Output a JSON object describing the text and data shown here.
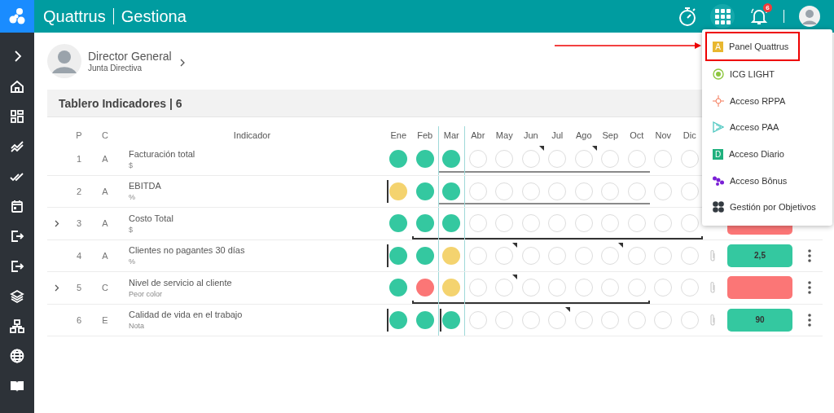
{
  "app": {
    "title": "Quattrus",
    "subtitle": "Gestiona"
  },
  "topbar": {
    "notifications": "6"
  },
  "profile": {
    "name": "Director General",
    "group": "Junta Directiva"
  },
  "panel": {
    "title": "Tablero Indicadores | 6"
  },
  "columns": {
    "p": "P",
    "c": "C",
    "indicator": "Indicador"
  },
  "months": [
    {
      "label": "Ene",
      "current": false
    },
    {
      "label": "Feb",
      "current": false
    },
    {
      "label": "Mar",
      "current": true
    },
    {
      "label": "Abr",
      "current": false
    },
    {
      "label": "May",
      "current": false
    },
    {
      "label": "Jun",
      "current": false
    },
    {
      "label": "Jul",
      "current": false
    },
    {
      "label": "Ago",
      "current": false
    },
    {
      "label": "Sep",
      "current": false
    },
    {
      "label": "Oct",
      "current": false
    },
    {
      "label": "Nov",
      "current": false
    },
    {
      "label": "Dic",
      "current": false
    }
  ],
  "rows": [
    {
      "p": "1",
      "c": "A",
      "name": "Facturación total",
      "unit": "$",
      "expandable": false,
      "range": {
        "kind": "line"
      },
      "months": [
        {
          "kind": "dot",
          "color": "#34c8a0"
        },
        {
          "kind": "dot",
          "color": "#34c8a0"
        },
        {
          "kind": "dot",
          "color": "#34c8a0",
          "in_range": true
        },
        {
          "kind": "ring",
          "in_range": true
        },
        {
          "kind": "ring",
          "in_range": true
        },
        {
          "kind": "ring",
          "flag": true,
          "in_range": true
        },
        {
          "kind": "ring",
          "in_range": true
        },
        {
          "kind": "ring",
          "flag": true,
          "in_range": true
        },
        {
          "kind": "ring",
          "in_range": true
        },
        {
          "kind": "ring",
          "in_range": true
        },
        {
          "kind": "ring"
        },
        {
          "kind": "ring"
        }
      ]
    },
    {
      "p": "2",
      "c": "A",
      "name": "EBITDA",
      "unit": "%",
      "expandable": false,
      "range": {
        "kind": "line"
      },
      "months": [
        {
          "kind": "dot",
          "color": "#f4d36f",
          "marker": true
        },
        {
          "kind": "dot",
          "color": "#34c8a0"
        },
        {
          "kind": "dot",
          "color": "#34c8a0",
          "in_range": true
        },
        {
          "kind": "ring",
          "in_range": true
        },
        {
          "kind": "ring",
          "in_range": true
        },
        {
          "kind": "ring",
          "in_range": true
        },
        {
          "kind": "ring",
          "in_range": true
        },
        {
          "kind": "ring",
          "in_range": true
        },
        {
          "kind": "ring",
          "in_range": true
        },
        {
          "kind": "ring",
          "in_range": true
        },
        {
          "kind": "ring"
        },
        {
          "kind": "ring"
        }
      ]
    },
    {
      "p": "3",
      "c": "A",
      "name": "Costo Total",
      "unit": "$",
      "expandable": true,
      "range": {
        "kind": "bracket"
      },
      "months": [
        {
          "kind": "dot",
          "color": "#34c8a0"
        },
        {
          "kind": "dot",
          "color": "#34c8a0",
          "in_range": true
        },
        {
          "kind": "dot",
          "color": "#34c8a0",
          "in_range": true
        },
        {
          "kind": "ring",
          "in_range": true
        },
        {
          "kind": "ring",
          "in_range": true
        },
        {
          "kind": "ring",
          "in_range": true
        },
        {
          "kind": "ring",
          "in_range": true
        },
        {
          "kind": "ring",
          "in_range": true
        },
        {
          "kind": "ring",
          "in_range": true
        },
        {
          "kind": "ring",
          "in_range": true
        },
        {
          "kind": "ring",
          "in_range": true
        },
        {
          "kind": "ring",
          "in_range": true
        }
      ],
      "value": {
        "color": "#fb7676"
      }
    },
    {
      "p": "4",
      "c": "A",
      "name": "Clientes no pagantes 30 días",
      "unit": "%",
      "expandable": false,
      "months": [
        {
          "kind": "dot",
          "color": "#34c8a0",
          "marker": true
        },
        {
          "kind": "dot",
          "color": "#34c8a0"
        },
        {
          "kind": "dot",
          "color": "#f4d36f"
        },
        {
          "kind": "ring"
        },
        {
          "kind": "ring",
          "flag": true
        },
        {
          "kind": "ring"
        },
        {
          "kind": "ring"
        },
        {
          "kind": "ring"
        },
        {
          "kind": "ring",
          "flag": true
        },
        {
          "kind": "ring"
        },
        {
          "kind": "ring"
        },
        {
          "kind": "ring"
        }
      ],
      "attachment": true,
      "value": {
        "text": "2,5",
        "color": "#34c8a0"
      },
      "menu": true
    },
    {
      "p": "5",
      "c": "C",
      "name": "Nivel de servicio al cliente",
      "unit": "Peor color",
      "expandable": true,
      "range": {
        "kind": "bracket"
      },
      "months": [
        {
          "kind": "dot",
          "color": "#34c8a0"
        },
        {
          "kind": "dot",
          "color": "#fb7676",
          "in_range": true
        },
        {
          "kind": "dot",
          "color": "#f4d36f",
          "in_range": true
        },
        {
          "kind": "ring",
          "in_range": true
        },
        {
          "kind": "ring",
          "flag": true,
          "in_range": true
        },
        {
          "kind": "ring",
          "in_range": true
        },
        {
          "kind": "ring",
          "in_range": true
        },
        {
          "kind": "ring",
          "in_range": true
        },
        {
          "kind": "ring",
          "in_range": true
        },
        {
          "kind": "ring",
          "in_range": true
        },
        {
          "kind": "ring"
        },
        {
          "kind": "ring"
        }
      ],
      "attachment": true,
      "value": {
        "color": "#fb7676"
      },
      "menu": true
    },
    {
      "p": "6",
      "c": "E",
      "name": "Calidad de vida en el trabajo",
      "unit": "Nota",
      "expandable": false,
      "months": [
        {
          "kind": "dot",
          "color": "#34c8a0",
          "marker": true
        },
        {
          "kind": "dot",
          "color": "#34c8a0"
        },
        {
          "kind": "dot",
          "color": "#34c8a0",
          "marker": true
        },
        {
          "kind": "ring"
        },
        {
          "kind": "ring"
        },
        {
          "kind": "ring"
        },
        {
          "kind": "ring",
          "flag": true
        },
        {
          "kind": "ring"
        },
        {
          "kind": "ring"
        },
        {
          "kind": "ring"
        },
        {
          "kind": "ring"
        },
        {
          "kind": "ring"
        }
      ],
      "attachment": true,
      "value": {
        "text": "90",
        "color": "#34c8a0"
      },
      "menu": true
    }
  ],
  "apps_menu": [
    {
      "label": "Panel Quattrus",
      "kind": "letter",
      "letter": "A",
      "color": "#e8b730",
      "highlighted": true
    },
    {
      "label": "ICG LIGHT",
      "kind": "target",
      "highlighted": false
    },
    {
      "label": "Acceso RPPA",
      "kind": "cross",
      "highlighted": false
    },
    {
      "label": "Acceso PAA",
      "kind": "triangle",
      "highlighted": false
    },
    {
      "label": "Acceso Diario",
      "kind": "letter",
      "letter": "D",
      "color": "#1fb07d",
      "highlighted": false
    },
    {
      "label": "Acceso Bônus",
      "kind": "dots",
      "highlighted": false
    },
    {
      "label": "Gestión por Objetivos",
      "kind": "quad",
      "highlighted": false
    }
  ]
}
